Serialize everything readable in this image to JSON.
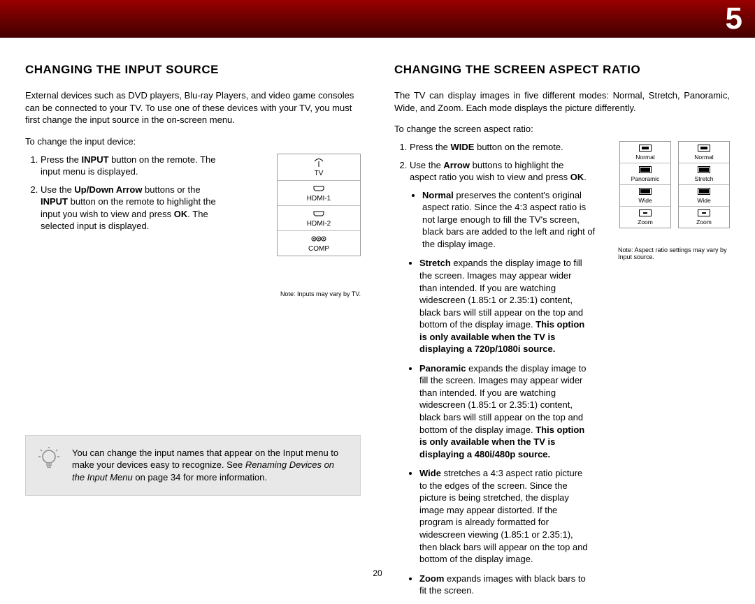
{
  "header": {
    "chapter_number": "5"
  },
  "page_number": "20",
  "left": {
    "title": "CHANGING THE INPUT SOURCE",
    "intro": "External devices such as DVD players, Blu-ray Players, and video game consoles can be connected to your TV. To use one of these devices with your TV, you must first change the input source in the on-screen menu.",
    "list_intro": "To change the input device:",
    "step1_pre": "Press the ",
    "step1_bold": "INPUT",
    "step1_post": " button on the remote. The input menu is displayed.",
    "step2_pre": "Use the ",
    "step2_bold1": "Up/Down Arrow",
    "step2_mid": " buttons or the ",
    "step2_bold2": "INPUT",
    "step2_mid2": " button on the remote to highlight the input you wish to view and press ",
    "step2_bold3": "OK",
    "step2_post": ". The selected input is displayed.",
    "input_menu": {
      "items": [
        {
          "icon": "antenna",
          "label": "TV"
        },
        {
          "icon": "hdmi",
          "label": "HDMI-1"
        },
        {
          "icon": "hdmi",
          "label": "HDMI-2"
        },
        {
          "icon": "component",
          "label": "COMP"
        }
      ],
      "note": "Note: Inputs may vary by TV."
    },
    "tip": {
      "line1": "You can change the input names that appear on the Input menu to make your devices easy to recognize. See ",
      "italic": "Renaming Devices on the Input Menu",
      "line2": " on page 34 for more information."
    }
  },
  "right": {
    "title": "CHANGING THE SCREEN ASPECT RATIO",
    "intro": "The TV can display images in five different modes: Normal, Stretch, Panoramic, Wide, and Zoom. Each mode displays the picture differently.",
    "list_intro": "To change the screen aspect ratio:",
    "step1_pre": "Press the ",
    "step1_bold": "WIDE",
    "step1_post": " button on the remote.",
    "step2_pre": "Use the ",
    "step2_bold1": "Arrow",
    "step2_mid": " buttons to highlight the aspect ratio you wish to view and press ",
    "step2_bold2": "OK",
    "step2_post": ".",
    "aspect_cols": [
      [
        "Normal",
        "Panoramic",
        "Wide",
        "Zoom"
      ],
      [
        "Normal",
        "Stretch",
        "Wide",
        "Zoom"
      ]
    ],
    "aspect_note": "Note: Aspect ratio settings may vary by Input source.",
    "bullets": {
      "normal_bold": "Normal",
      "normal_text": " preserves the content's original aspect ratio. Since the 4:3 aspect ratio is not large enough to fill the TV's screen, black bars are added to the left and right of the display image.",
      "stretch_bold": "Stretch",
      "stretch_text": " expands the display image to fill the screen. Images may appear wider than intended. If you are watching widescreen (1.85:1 or 2.35:1) content, black bars will still appear on the top and bottom of the display image. ",
      "stretch_bold2": "This option is only available when the TV is displaying a 720p/1080i source.",
      "panoramic_bold": "Panoramic",
      "panoramic_text": " expands the display image to fill the screen. Images may appear wider than intended. If you are watching widescreen (1.85:1 or 2.35:1) content, black bars will still appear on the top and bottom of the display image. ",
      "panoramic_bold2": "This option is only available when the TV is displaying a 480i/480p source.",
      "wide_bold": "Wide",
      "wide_text": " stretches a 4:3 aspect ratio picture to the edges of the screen. Since the picture is being stretched, the display image may appear distorted. If the program is already formatted for widescreen viewing (1.85:1 or 2.35:1), then black bars will appear on the top and bottom of the display image.",
      "zoom_bold": "Zoom",
      "zoom_text": " expands images with black bars to fit the screen."
    }
  }
}
